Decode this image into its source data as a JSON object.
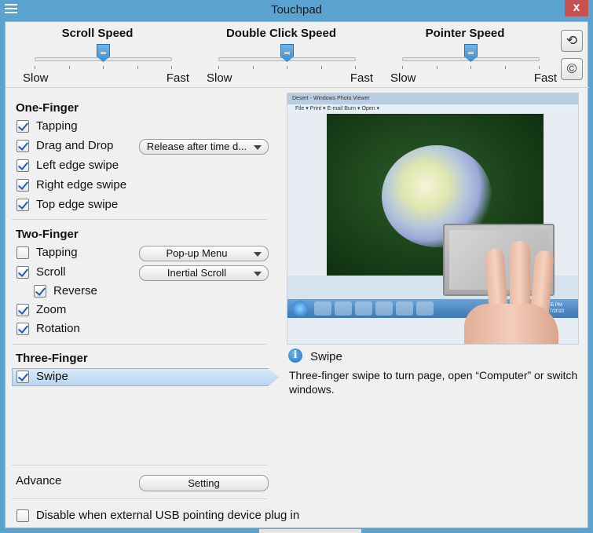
{
  "window": {
    "title": "Touchpad",
    "close_label": "x"
  },
  "speeds": [
    {
      "title": "Scroll Speed",
      "slow": "Slow",
      "fast": "Fast",
      "level": 0.5
    },
    {
      "title": "Double Click Speed",
      "slow": "Slow",
      "fast": "Fast",
      "level": 0.5
    },
    {
      "title": "Pointer Speed",
      "slow": "Slow",
      "fast": "Fast",
      "level": 0.5
    }
  ],
  "side_buttons": {
    "reset_icon": "undo-icon",
    "copyright_icon": "copyright-icon",
    "reset_glyph": "⟲",
    "copyright_glyph": "©"
  },
  "one_finger": {
    "title": "One-Finger",
    "items": [
      {
        "label": "Tapping",
        "checked": true
      },
      {
        "label": "Drag and Drop",
        "checked": true,
        "dropdown": "Release after time d..."
      },
      {
        "label": "Left edge swipe",
        "checked": true
      },
      {
        "label": "Right edge swipe",
        "checked": true
      },
      {
        "label": "Top edge swipe",
        "checked": true
      }
    ]
  },
  "two_finger": {
    "title": "Two-Finger",
    "items": [
      {
        "label": "Tapping",
        "checked": false,
        "dropdown": "Pop-up Menu"
      },
      {
        "label": "Scroll",
        "checked": true,
        "dropdown": "Inertial Scroll"
      },
      {
        "label": "Reverse",
        "checked": true
      },
      {
        "label": "Zoom",
        "checked": true
      },
      {
        "label": "Rotation",
        "checked": true
      }
    ]
  },
  "three_finger": {
    "title": "Three-Finger",
    "items": [
      {
        "label": "Swipe",
        "checked": true,
        "selected": true
      }
    ]
  },
  "advance": {
    "label": "Advance",
    "button": "Setting"
  },
  "disable_usb": {
    "label": "Disable when external USB pointing device plug in",
    "checked": false
  },
  "preview": {
    "window_title": "Desert - Windows Photo Viewer",
    "menu": "File ▾    Print ▾    E-mail    Burn ▾    Open ▾",
    "clock_time": "2:05 PM",
    "clock_date": "6/17/2010"
  },
  "info": {
    "icon": "info-icon",
    "glyph": "i",
    "title": "Swipe",
    "description": "Three-finger swipe to turn page, open “Computer” or switch windows."
  }
}
